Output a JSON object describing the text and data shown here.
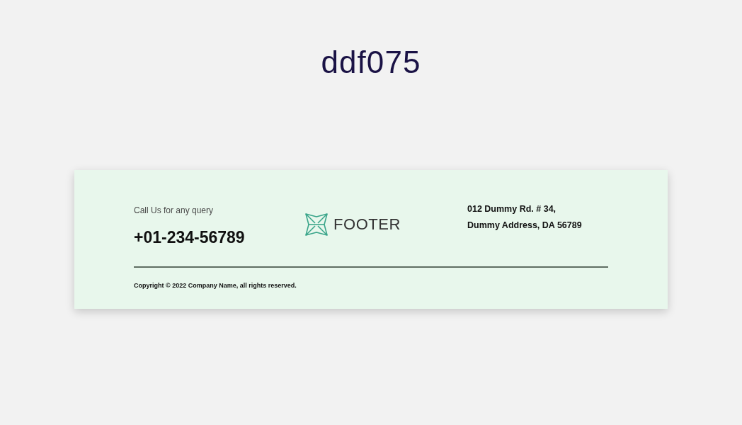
{
  "heading": "ddf075",
  "footer": {
    "contact": {
      "label": "Call Us for any query",
      "phone": "+01-234-56789"
    },
    "logo": {
      "text": "FOOTER"
    },
    "address": [
      "012 Dummy Rd. # 34,",
      "Dummy Address, DA 56789"
    ],
    "copyright": "Copyright © 2022 Company Name, all rights reserved."
  }
}
